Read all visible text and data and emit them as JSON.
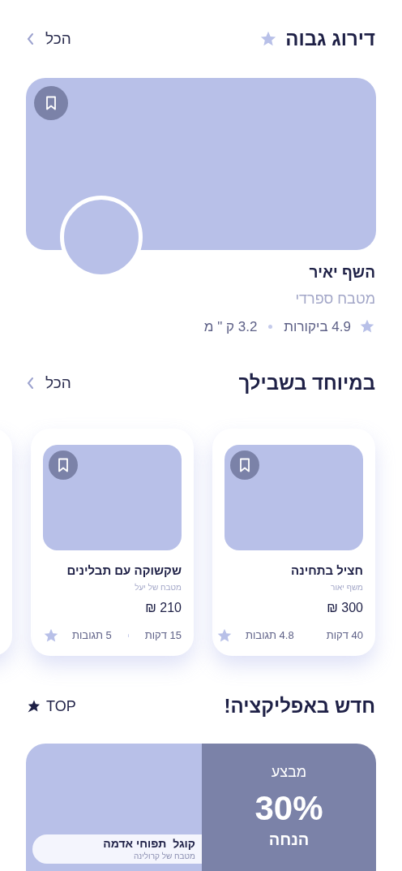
{
  "top_rated": {
    "title": "דירוג גבוה",
    "see_all": "הכל",
    "chef": {
      "name": "השף יאיר",
      "cuisine": "מטבח ספרדי",
      "rating": "4.9 ביקורות",
      "distance": "3.2 ק \" מ"
    }
  },
  "for_you": {
    "title": "במיוחד בשבילך",
    "see_all": "הכל",
    "dishes": [
      {
        "name": "חציל בתחינה",
        "chef": "משף יאור",
        "price": "300 ₪",
        "time": "40 דקות",
        "reviews": "4.8 תגובות"
      },
      {
        "name": "שקשוקה עם תבלינים",
        "chef": "מטבח של יעל",
        "price": "210 ₪",
        "time": "15 דקות",
        "reviews": "5 תגובות"
      }
    ]
  },
  "new_in_app": {
    "title": "חדש באפליקציה!",
    "badge": "TOP",
    "promo": {
      "label": "מבצע",
      "percent": "30%",
      "caption": "הנחה",
      "dish": "קוגל  תפוחי אדמה",
      "chef": "מטבח של קרולינה"
    }
  }
}
